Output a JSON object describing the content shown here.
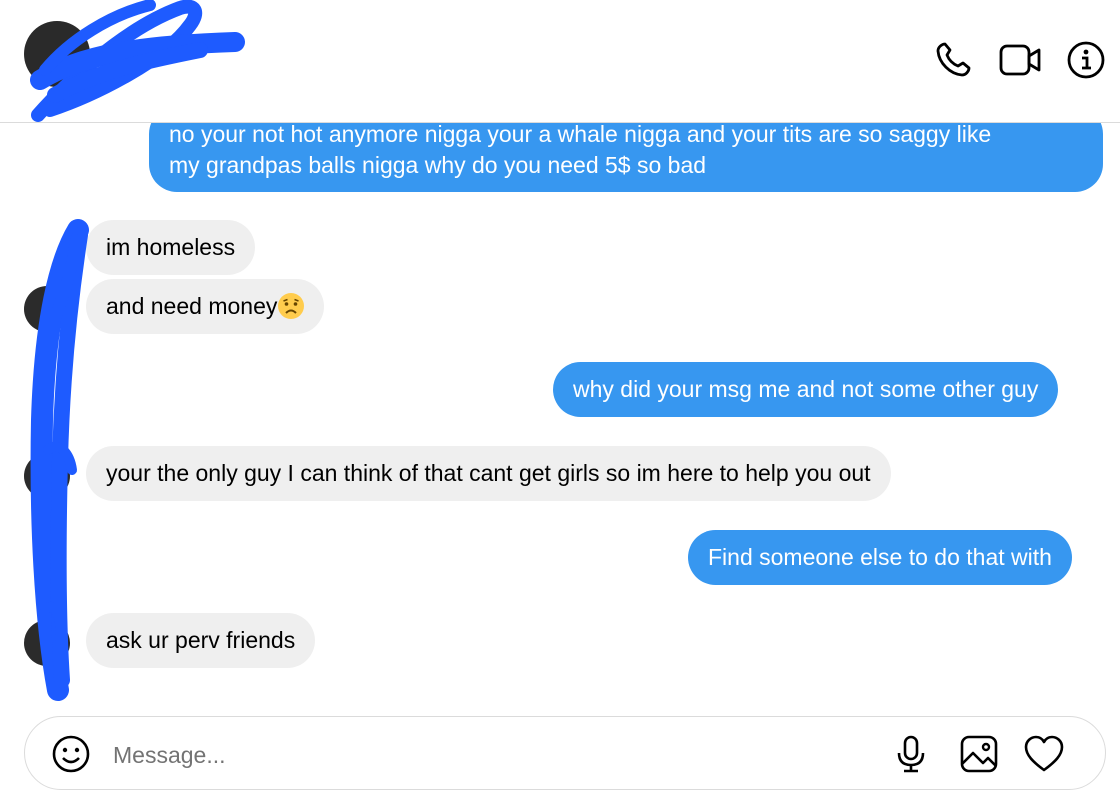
{
  "header": {
    "icons": [
      "phone-icon",
      "video-call-icon",
      "info-icon"
    ]
  },
  "messages": [
    {
      "direction": "outgoing",
      "lines": [
        "no your not hot anymore nigga your a whale nigga and your tits are so saggy like",
        "my grandpas balls nigga why do you need 5$ so bad"
      ]
    },
    {
      "direction": "incoming",
      "text": "im homeless"
    },
    {
      "direction": "incoming",
      "text": "and need money",
      "emoji": "disappointed-face"
    },
    {
      "direction": "outgoing",
      "text": "why did your msg me and not some other guy"
    },
    {
      "direction": "incoming",
      "text": "your the only guy I can think of that cant get girls so im here to help you out"
    },
    {
      "direction": "outgoing",
      "text": "Find someone else to do that with"
    },
    {
      "direction": "incoming",
      "text": "ask ur perv friends"
    }
  ],
  "composer": {
    "placeholder": "Message...",
    "icons": [
      "emoji-icon",
      "microphone-icon",
      "image-icon",
      "heart-icon"
    ]
  },
  "colors": {
    "outgoing_bubble": "#3797f0",
    "incoming_bubble": "#efefef",
    "redaction": "#1e5bff"
  }
}
